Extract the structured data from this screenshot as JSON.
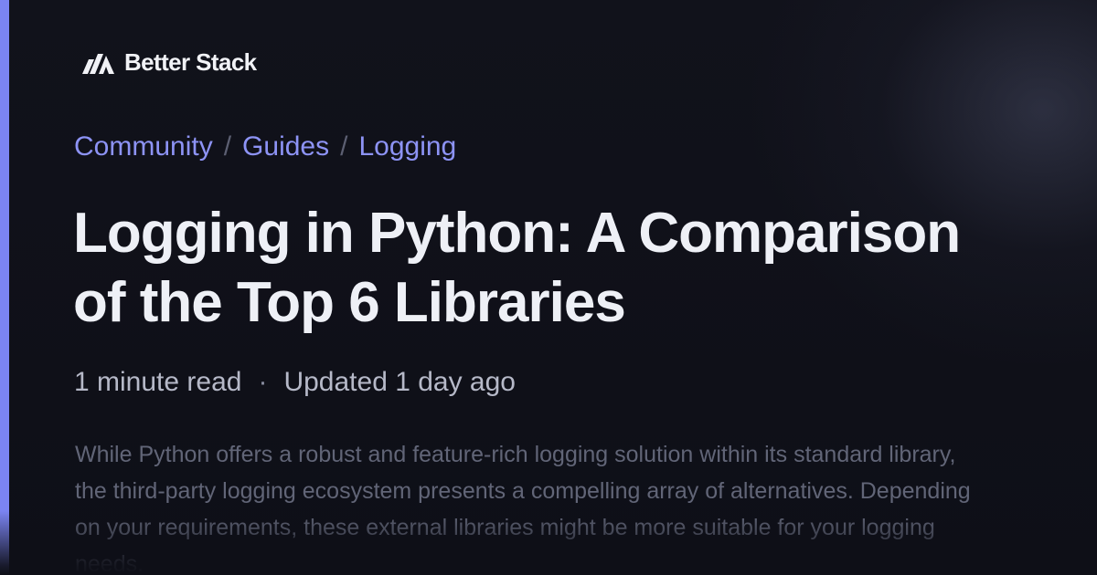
{
  "brand": {
    "name": "Better Stack",
    "logo_icon": "better-stack-logo-icon",
    "accent_color": "#7b84f2"
  },
  "breadcrumb": {
    "items": [
      "Community",
      "Guides",
      "Logging"
    ],
    "separator": "/"
  },
  "article": {
    "title": "Logging in Python: A Comparison of the Top 6 Libraries",
    "read_time": "1 minute read",
    "meta_separator": "·",
    "updated": "Updated 1 day ago",
    "excerpt": "While Python offers a robust and feature-rich logging solution within its standard library, the third-party logging ecosystem presents a compelling array of alternatives. Depending on your requirements, these external libraries might be more suitable for your logging needs."
  },
  "colors": {
    "background": "#0f1018",
    "breadcrumb_link": "#8d93f5",
    "title": "#eef0f6",
    "meta": "#b6b9c8",
    "excerpt": "#616577"
  }
}
